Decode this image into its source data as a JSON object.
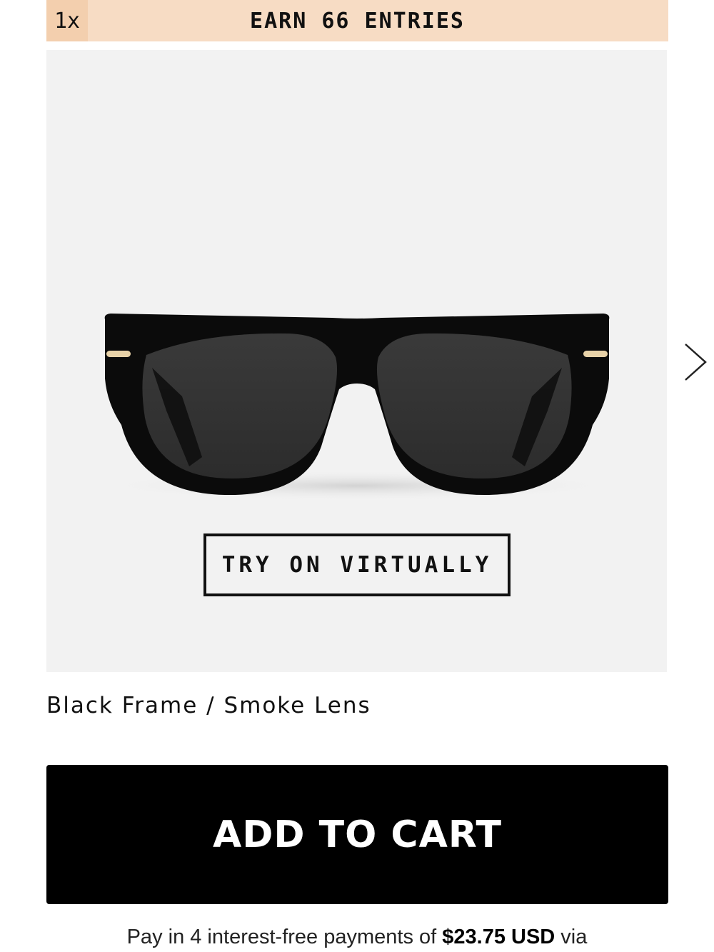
{
  "promo": {
    "multiplier": "1x",
    "text": "EARN 66 ENTRIES",
    "colors": {
      "bar": "#f7dcc4",
      "multiplier_bg": "#f3cfae"
    }
  },
  "product_image": {
    "alt": "Black cat-eye sunglasses with smoke lenses",
    "background": "#f2f2f2",
    "next_icon": "chevron-right-icon"
  },
  "try_on": {
    "label": "TRY ON VIRTUALLY"
  },
  "variant": {
    "label": "Black Frame / Smoke Lens"
  },
  "cart": {
    "label": "ADD TO CART"
  },
  "installments": {
    "prefix": "Pay in 4 interest-free payments of ",
    "amount": "$23.75 USD",
    "suffix": " via"
  }
}
